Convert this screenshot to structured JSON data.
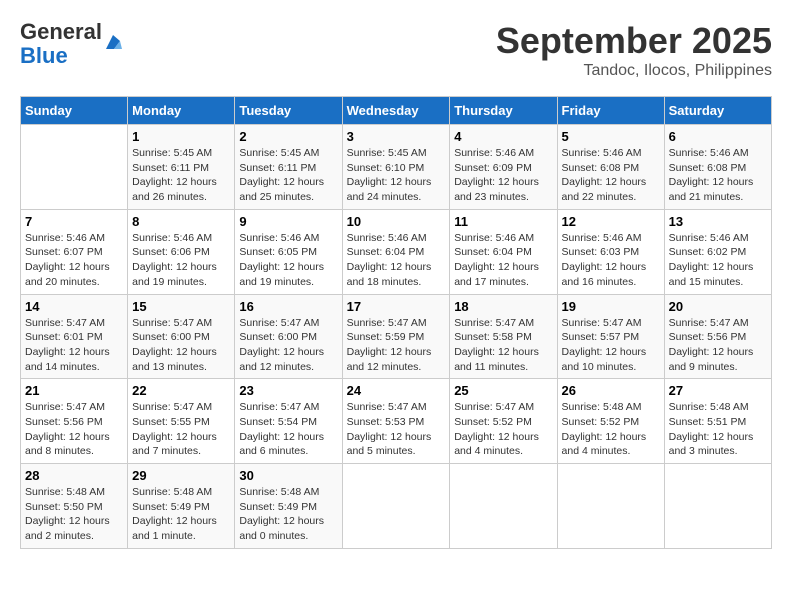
{
  "header": {
    "logo_general": "General",
    "logo_blue": "Blue",
    "month_title": "September 2025",
    "location": "Tandoc, Ilocos, Philippines"
  },
  "days_of_week": [
    "Sunday",
    "Monday",
    "Tuesday",
    "Wednesday",
    "Thursday",
    "Friday",
    "Saturday"
  ],
  "weeks": [
    [
      {
        "day": "",
        "info": ""
      },
      {
        "day": "1",
        "info": "Sunrise: 5:45 AM\nSunset: 6:11 PM\nDaylight: 12 hours\nand 26 minutes."
      },
      {
        "day": "2",
        "info": "Sunrise: 5:45 AM\nSunset: 6:11 PM\nDaylight: 12 hours\nand 25 minutes."
      },
      {
        "day": "3",
        "info": "Sunrise: 5:45 AM\nSunset: 6:10 PM\nDaylight: 12 hours\nand 24 minutes."
      },
      {
        "day": "4",
        "info": "Sunrise: 5:46 AM\nSunset: 6:09 PM\nDaylight: 12 hours\nand 23 minutes."
      },
      {
        "day": "5",
        "info": "Sunrise: 5:46 AM\nSunset: 6:08 PM\nDaylight: 12 hours\nand 22 minutes."
      },
      {
        "day": "6",
        "info": "Sunrise: 5:46 AM\nSunset: 6:08 PM\nDaylight: 12 hours\nand 21 minutes."
      }
    ],
    [
      {
        "day": "7",
        "info": "Sunrise: 5:46 AM\nSunset: 6:07 PM\nDaylight: 12 hours\nand 20 minutes."
      },
      {
        "day": "8",
        "info": "Sunrise: 5:46 AM\nSunset: 6:06 PM\nDaylight: 12 hours\nand 19 minutes."
      },
      {
        "day": "9",
        "info": "Sunrise: 5:46 AM\nSunset: 6:05 PM\nDaylight: 12 hours\nand 19 minutes."
      },
      {
        "day": "10",
        "info": "Sunrise: 5:46 AM\nSunset: 6:04 PM\nDaylight: 12 hours\nand 18 minutes."
      },
      {
        "day": "11",
        "info": "Sunrise: 5:46 AM\nSunset: 6:04 PM\nDaylight: 12 hours\nand 17 minutes."
      },
      {
        "day": "12",
        "info": "Sunrise: 5:46 AM\nSunset: 6:03 PM\nDaylight: 12 hours\nand 16 minutes."
      },
      {
        "day": "13",
        "info": "Sunrise: 5:46 AM\nSunset: 6:02 PM\nDaylight: 12 hours\nand 15 minutes."
      }
    ],
    [
      {
        "day": "14",
        "info": "Sunrise: 5:47 AM\nSunset: 6:01 PM\nDaylight: 12 hours\nand 14 minutes."
      },
      {
        "day": "15",
        "info": "Sunrise: 5:47 AM\nSunset: 6:00 PM\nDaylight: 12 hours\nand 13 minutes."
      },
      {
        "day": "16",
        "info": "Sunrise: 5:47 AM\nSunset: 6:00 PM\nDaylight: 12 hours\nand 12 minutes."
      },
      {
        "day": "17",
        "info": "Sunrise: 5:47 AM\nSunset: 5:59 PM\nDaylight: 12 hours\nand 12 minutes."
      },
      {
        "day": "18",
        "info": "Sunrise: 5:47 AM\nSunset: 5:58 PM\nDaylight: 12 hours\nand 11 minutes."
      },
      {
        "day": "19",
        "info": "Sunrise: 5:47 AM\nSunset: 5:57 PM\nDaylight: 12 hours\nand 10 minutes."
      },
      {
        "day": "20",
        "info": "Sunrise: 5:47 AM\nSunset: 5:56 PM\nDaylight: 12 hours\nand 9 minutes."
      }
    ],
    [
      {
        "day": "21",
        "info": "Sunrise: 5:47 AM\nSunset: 5:56 PM\nDaylight: 12 hours\nand 8 minutes."
      },
      {
        "day": "22",
        "info": "Sunrise: 5:47 AM\nSunset: 5:55 PM\nDaylight: 12 hours\nand 7 minutes."
      },
      {
        "day": "23",
        "info": "Sunrise: 5:47 AM\nSunset: 5:54 PM\nDaylight: 12 hours\nand 6 minutes."
      },
      {
        "day": "24",
        "info": "Sunrise: 5:47 AM\nSunset: 5:53 PM\nDaylight: 12 hours\nand 5 minutes."
      },
      {
        "day": "25",
        "info": "Sunrise: 5:47 AM\nSunset: 5:52 PM\nDaylight: 12 hours\nand 4 minutes."
      },
      {
        "day": "26",
        "info": "Sunrise: 5:48 AM\nSunset: 5:52 PM\nDaylight: 12 hours\nand 4 minutes."
      },
      {
        "day": "27",
        "info": "Sunrise: 5:48 AM\nSunset: 5:51 PM\nDaylight: 12 hours\nand 3 minutes."
      }
    ],
    [
      {
        "day": "28",
        "info": "Sunrise: 5:48 AM\nSunset: 5:50 PM\nDaylight: 12 hours\nand 2 minutes."
      },
      {
        "day": "29",
        "info": "Sunrise: 5:48 AM\nSunset: 5:49 PM\nDaylight: 12 hours\nand 1 minute."
      },
      {
        "day": "30",
        "info": "Sunrise: 5:48 AM\nSunset: 5:49 PM\nDaylight: 12 hours\nand 0 minutes."
      },
      {
        "day": "",
        "info": ""
      },
      {
        "day": "",
        "info": ""
      },
      {
        "day": "",
        "info": ""
      },
      {
        "day": "",
        "info": ""
      }
    ]
  ]
}
